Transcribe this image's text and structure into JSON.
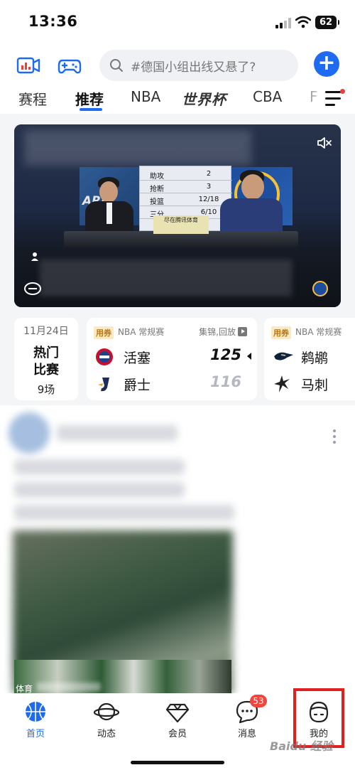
{
  "status": {
    "time": "13:36",
    "battery": "62"
  },
  "search": {
    "placeholder": "#德国小组出线又悬了?"
  },
  "tabs": [
    "赛程",
    "推荐",
    "NBA",
    "世界杯",
    "CBA",
    "F"
  ],
  "video": {
    "stats": [
      {
        "k": "助攻",
        "v": "2"
      },
      {
        "k": "抢断",
        "v": "3"
      },
      {
        "k": "投篮",
        "v": "12/18"
      },
      {
        "k": "三分",
        "v": "6/10"
      }
    ],
    "screen_text": "ARR",
    "desk_text": "尽在腾讯体育"
  },
  "date_card": {
    "date": "11月24日",
    "hot": "热门\n比赛",
    "count": "9场"
  },
  "game1": {
    "badge": "用券",
    "league": "NBA 常规赛",
    "replay": "集锦,回放",
    "home": {
      "name": "活塞",
      "score": "125"
    },
    "away": {
      "name": "爵士",
      "score": "116"
    }
  },
  "game2": {
    "badge": "用券",
    "league": "NBA 常规赛",
    "home": {
      "name": "鹈鹕"
    },
    "away": {
      "name": "马刺"
    }
  },
  "feed": {
    "caption": "体育"
  },
  "nav": [
    {
      "label": "首页",
      "icon": "basketball-icon"
    },
    {
      "label": "动态",
      "icon": "planet-icon"
    },
    {
      "label": "会员",
      "icon": "diamond-icon"
    },
    {
      "label": "消息",
      "icon": "chat-icon",
      "badge": "53"
    },
    {
      "label": "我的",
      "icon": "profile-icon"
    }
  ],
  "watermark": "Baidu 经验",
  "colors": {
    "accent": "#1e6bf1",
    "badge_red": "#f0463d",
    "highlight": "#e21f1f"
  }
}
